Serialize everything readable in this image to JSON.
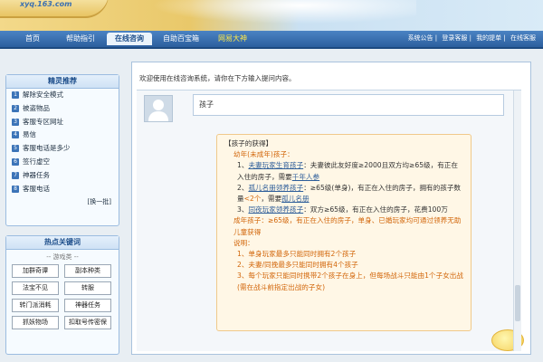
{
  "banner": {
    "url": "xyq.163.com"
  },
  "nav": {
    "tabs": [
      {
        "label": "首页"
      },
      {
        "label": "帮助指引"
      },
      {
        "label": "在线咨询"
      },
      {
        "label": "自助百宝箱"
      },
      {
        "label": "网易大神"
      }
    ],
    "right_links": [
      "系统公告",
      "登录客服",
      "我的提单",
      "在线客服"
    ]
  },
  "sidebar": {
    "title": "精灵推荐",
    "items": [
      {
        "num": "1",
        "label": "解除安全模式"
      },
      {
        "num": "2",
        "label": "被盗物品"
      },
      {
        "num": "3",
        "label": "客服专区网址"
      },
      {
        "num": "4",
        "label": "易信"
      },
      {
        "num": "5",
        "label": "客服电话是多少"
      },
      {
        "num": "6",
        "label": "签行虚空"
      },
      {
        "num": "7",
        "label": "神器任务"
      },
      {
        "num": "8",
        "label": "客服电话"
      }
    ],
    "more": "[换一批]"
  },
  "hot": {
    "title": "热点关键词",
    "subtitle": "-- 游戏类 --",
    "keywords": [
      "加群奇谭",
      "副本种类",
      "法宝不见",
      "转服",
      "转门派消耗",
      "神器任务",
      "抓妖物场",
      "扣取号传密保"
    ]
  },
  "chat": {
    "welcome": "欢迎使用在线咨询系统，请你在下方输入提问内容。",
    "question": "孩子",
    "answer": {
      "title": "【孩子的获得】",
      "section1": "幼年(未成年)孩子：",
      "line1_num": "1、",
      "line1_link": "夫妻玩家生育孩子",
      "line1_text": "：夫妻彼此友好度≥2000且双方均≥65级，有正在入住的房子，需要",
      "line1_link2": "千年人参",
      "line2_num": "2、",
      "line2_link": "孤儿名册领养孩子",
      "line2_text": "：≥65级(单身)，有正在入住的房子，拥有的孩子数量",
      "line2_red": "<2个",
      "line2_text2": "，需要",
      "line2_link2": "孤儿名册",
      "line3_num": "3、",
      "line3_link": "同夜玩家领养孩子",
      "line3_text": "：双方≥65级，有正在入住的房子，花费100万",
      "section2": "成年孩子：≥65级，有正在入住的房子，单身、已婚玩家均可通过领养无助儿童获得",
      "note_title": "说明：",
      "note1": "1、单身玩家最多只能同时拥有2个孩子",
      "note2": "2、夫妻/同挽最多只能同时拥有4个孩子",
      "note3": "3、每个玩家只能同时携带2个孩子在身上，但每场战斗只能由1个子女出战(需在战斗前指定出战的子女)"
    }
  }
}
